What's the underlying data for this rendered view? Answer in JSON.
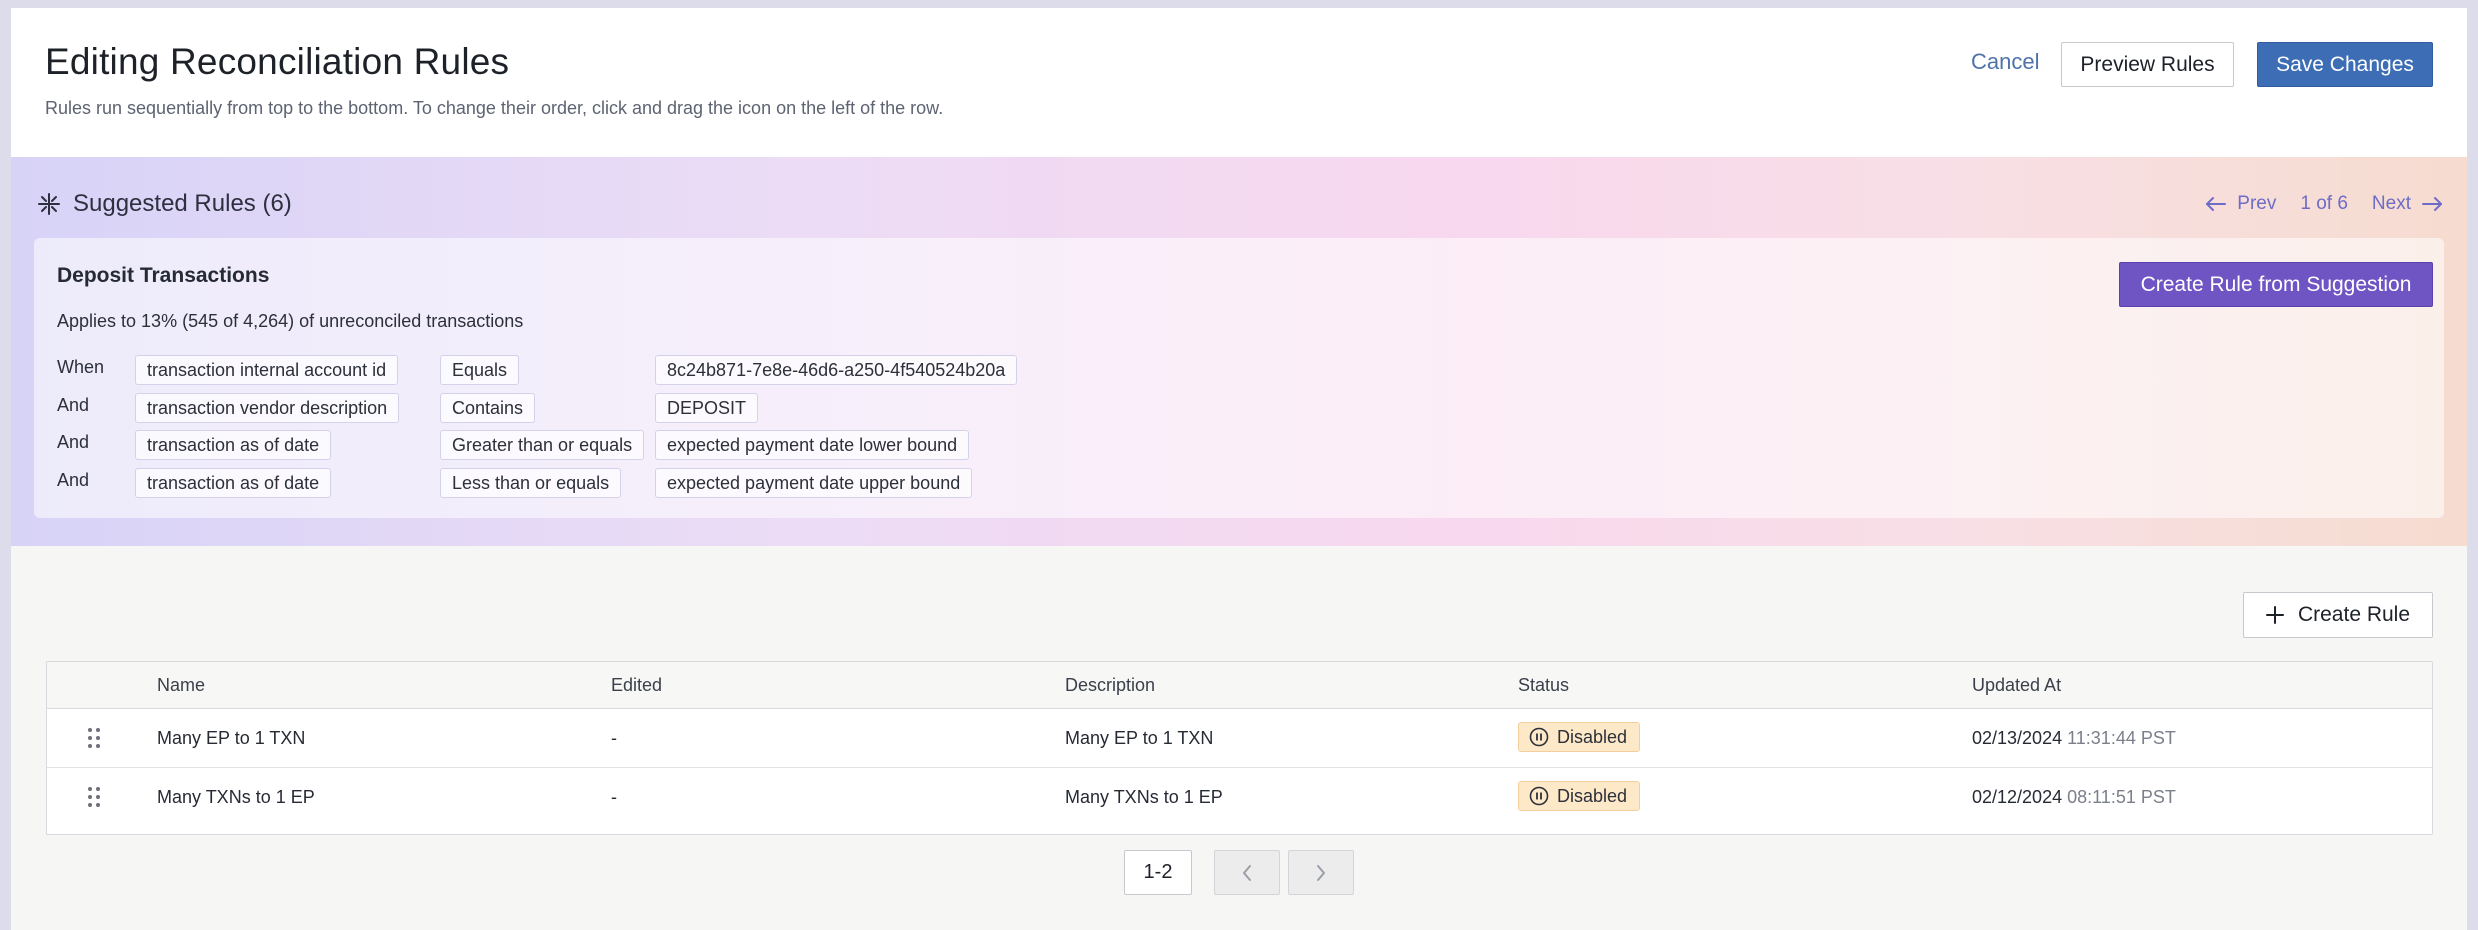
{
  "header": {
    "title": "Editing Reconciliation Rules",
    "subtitle": "Rules run sequentially from top to the bottom. To change their order, click and drag the icon on the left of the row.",
    "cancel_label": "Cancel",
    "preview_label": "Preview Rules",
    "save_label": "Save Changes"
  },
  "suggested": {
    "title": "Suggested Rules (6)",
    "prev_label": "Prev",
    "counter": "1 of 6",
    "next_label": "Next",
    "card": {
      "title": "Deposit Transactions",
      "applies": "Applies to 13% (545 of 4,264) of unreconciled transactions",
      "create_label": "Create Rule from Suggestion",
      "conditions": [
        {
          "join": "When",
          "field": "transaction internal account id",
          "operator": "Equals",
          "value": "8c24b871-7e8e-46d6-a250-4f540524b20a"
        },
        {
          "join": "And",
          "field": "transaction vendor description",
          "operator": "Contains",
          "value": "DEPOSIT"
        },
        {
          "join": "And",
          "field": "transaction as of date",
          "operator": "Greater than or equals",
          "value": "expected payment date lower bound"
        },
        {
          "join": "And",
          "field": "transaction as of date",
          "operator": "Less than or equals",
          "value": "expected payment date upper bound"
        }
      ]
    }
  },
  "rules": {
    "create_label": "Create Rule",
    "columns": [
      "Name",
      "Edited",
      "Description",
      "Status",
      "Updated At"
    ],
    "rows": [
      {
        "name": "Many EP to 1 TXN",
        "edited": "-",
        "description": "Many EP to 1 TXN",
        "status": "Disabled",
        "date": "02/13/2024",
        "time": "11:31:44 PST"
      },
      {
        "name": "Many TXNs to 1 EP",
        "edited": "-",
        "description": "Many TXNs to 1 EP",
        "status": "Disabled",
        "date": "02/12/2024",
        "time": "08:11:51 PST"
      }
    ],
    "pagination": {
      "range": "1-2"
    }
  },
  "colors": {
    "primary": "#3d6db5",
    "suggest_accent": "#6f55c3",
    "disabled_badge": "#fde8c8"
  },
  "icons": [
    "sparkle-icon",
    "arrow-left-icon",
    "arrow-right-icon",
    "plus-icon",
    "drag-handle-icon",
    "pause-icon",
    "chevron-left-icon",
    "chevron-right-icon"
  ]
}
